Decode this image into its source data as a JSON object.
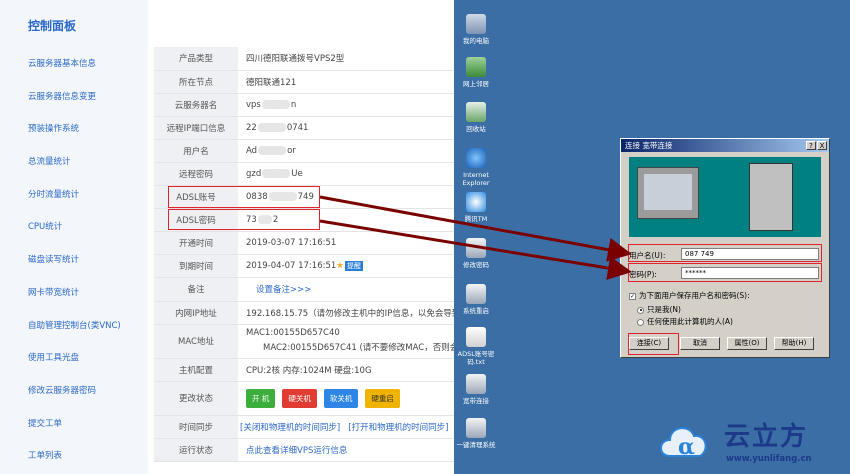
{
  "sidebar": {
    "title": "控制面板",
    "items": [
      {
        "label": "云服务器基本信息"
      },
      {
        "label": "云服务器信息变更"
      },
      {
        "label": "预装操作系统"
      },
      {
        "label": "总流量统计"
      },
      {
        "label": "分时流量统计"
      },
      {
        "label": "CPU统计"
      },
      {
        "label": "磁盘读写统计"
      },
      {
        "label": "网卡带宽统计"
      },
      {
        "label": "自助管理控制台(类VNC)"
      },
      {
        "label": "使用工具光盘"
      },
      {
        "label": "修改云服务器密码"
      },
      {
        "label": "提交工单"
      },
      {
        "label": "工单列表"
      }
    ]
  },
  "info": {
    "product_type": {
      "key": "产品类型",
      "value": "四川德阳联通拨号VPS2型"
    },
    "node": {
      "key": "所在节点",
      "value": "德阳联通121"
    },
    "server_name": {
      "key": "云服务器名",
      "value_a": "vps",
      "value_b": "n"
    },
    "remote_ip": {
      "key": "远程IP端口信息",
      "value_a": "22",
      "value_b": "0741"
    },
    "username": {
      "key": "用户名",
      "value_a": "Ad",
      "value_b": "or"
    },
    "remote_pwd": {
      "key": "远程密码",
      "value_a": "gzd",
      "value_b": "Ue"
    },
    "adsl_account": {
      "key": "ADSL账号",
      "value_a": "0838",
      "value_b": "749"
    },
    "adsl_pwd": {
      "key": "ADSL密码",
      "value_a": "73",
      "value_b": "2"
    },
    "open_time": {
      "key": "开通时间",
      "value": "2019-03-07 17:16:51"
    },
    "expire_time": {
      "key": "到期时间",
      "value": "2019-04-07 17:16:51",
      "badge": "提醒"
    },
    "remark": {
      "key": "备注",
      "link": "设置备注>>>"
    },
    "intranet_ip": {
      "key": "内网IP地址",
      "value": "192.168.15.75（请勿修改主机中的IP信息，以免会导致无"
    },
    "mac": {
      "key": "MAC地址",
      "mac1": "MAC1:00155D657C40",
      "mac2": "MAC2:00155D657C41 (请不要修改MAC，否则会导"
    },
    "host_config": {
      "key": "主机配置",
      "value": "CPU:2核 内存:1024M 硬盘:10G"
    },
    "state_change": {
      "key": "更改状态",
      "btn_on": "开 机",
      "btn_hard_off": "硬关机",
      "btn_soft_off": "软关机",
      "btn_hard_restart": "硬重启"
    },
    "time_sync": {
      "key": "时间同步",
      "close_link": "[关闭和物理机的时间同步]",
      "open_link": "[打开和物理机的时间同步]"
    },
    "run_state": {
      "key": "运行状态",
      "link": "点此查看详细VPS运行信息"
    }
  },
  "desktop": {
    "icons": [
      {
        "label": "我的电脑",
        "icon": "computer-icon"
      },
      {
        "label": "网上邻居",
        "icon": "network-icon"
      },
      {
        "label": "回收站",
        "icon": "recycle-bin-icon"
      },
      {
        "label": "Internet Explorer",
        "icon": "ie-icon"
      },
      {
        "label": "腾讯TM",
        "icon": "tm-icon"
      },
      {
        "label": "修改密码",
        "icon": "password-icon"
      },
      {
        "label": "系统重启",
        "icon": "restart-icon"
      },
      {
        "label": "ADSL账号密码.txt",
        "icon": "text-file-icon"
      },
      {
        "label": "宽带连接",
        "icon": "broadband-icon"
      },
      {
        "label": "一键清理系统",
        "icon": "cleanup-icon"
      }
    ]
  },
  "dialog": {
    "title": "连接 宽带连接",
    "help_btn": "?",
    "close_btn": "X",
    "username_label": "用户名(U):",
    "username_value": "087      749",
    "password_label": "密码(P):",
    "password_value": "******",
    "save_label": "为下面用户保存用户名和密码(S):",
    "only_me": "只是我(N)",
    "anyone": "任何使用此计算机的人(A)",
    "btn_connect": "连接(C)",
    "btn_cancel": "取消",
    "btn_props": "属性(O)",
    "btn_help": "帮助(H)"
  },
  "watermark": {
    "name": "云立方",
    "url": "www.yunlifang.cn"
  },
  "colors": {
    "highlight": "#e0242b",
    "arrow": "#7a0000",
    "desktop": "#3a6ea5",
    "link": "#2b69c7"
  }
}
